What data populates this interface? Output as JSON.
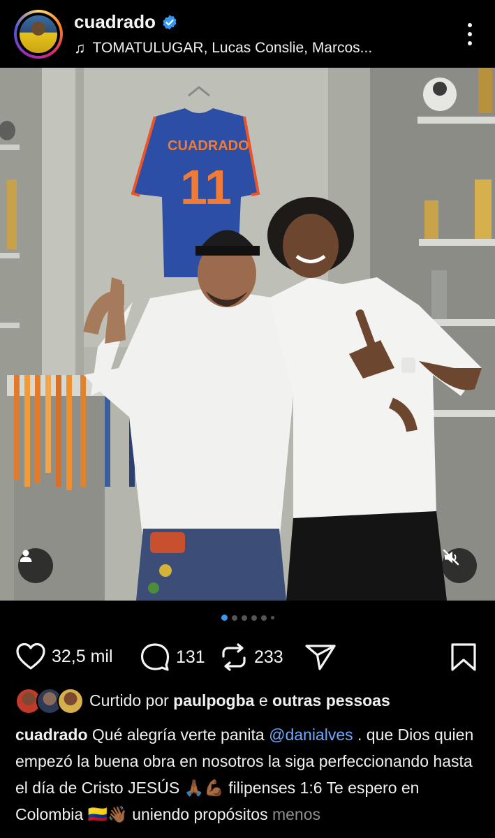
{
  "post": {
    "username": "cuadrado",
    "music": "TOMATULUGAR, Lucas Conslie, Marcos...",
    "icons": {
      "verified": "verified-badge-icon",
      "music": "music-note-icon",
      "more": "more-options-icon",
      "tag": "user-tag-icon",
      "mute": "muted-speaker-icon"
    },
    "carousel": {
      "count": 6,
      "active_index": 0
    }
  },
  "actions": {
    "like_count": "32,5 mil",
    "comment_count": "131",
    "repost_count": "233"
  },
  "likes": {
    "prefix": "Curtido por",
    "user": "paulpogba",
    "connector": "e",
    "others": "outras pessoas"
  },
  "caption": {
    "username": "cuadrado",
    "text_1": "Qué alegría verte panita",
    "mention": "@danialves",
    "text_2": ". que Dios quien empezó la buena obra en nosotros la siga perfeccionando hasta el día de  Cristo JESÚS 🙏🏾💪🏾 filipenses 1:6  Te espero en Colombia 🇨🇴👋🏾 uniendo propósitos",
    "more_label": "menos"
  },
  "colors": {
    "background": "#000000",
    "text": "#f5f5f5",
    "verified": "#3897f0",
    "mention": "#6ea8fe",
    "muted_text": "#8e8e8e"
  }
}
